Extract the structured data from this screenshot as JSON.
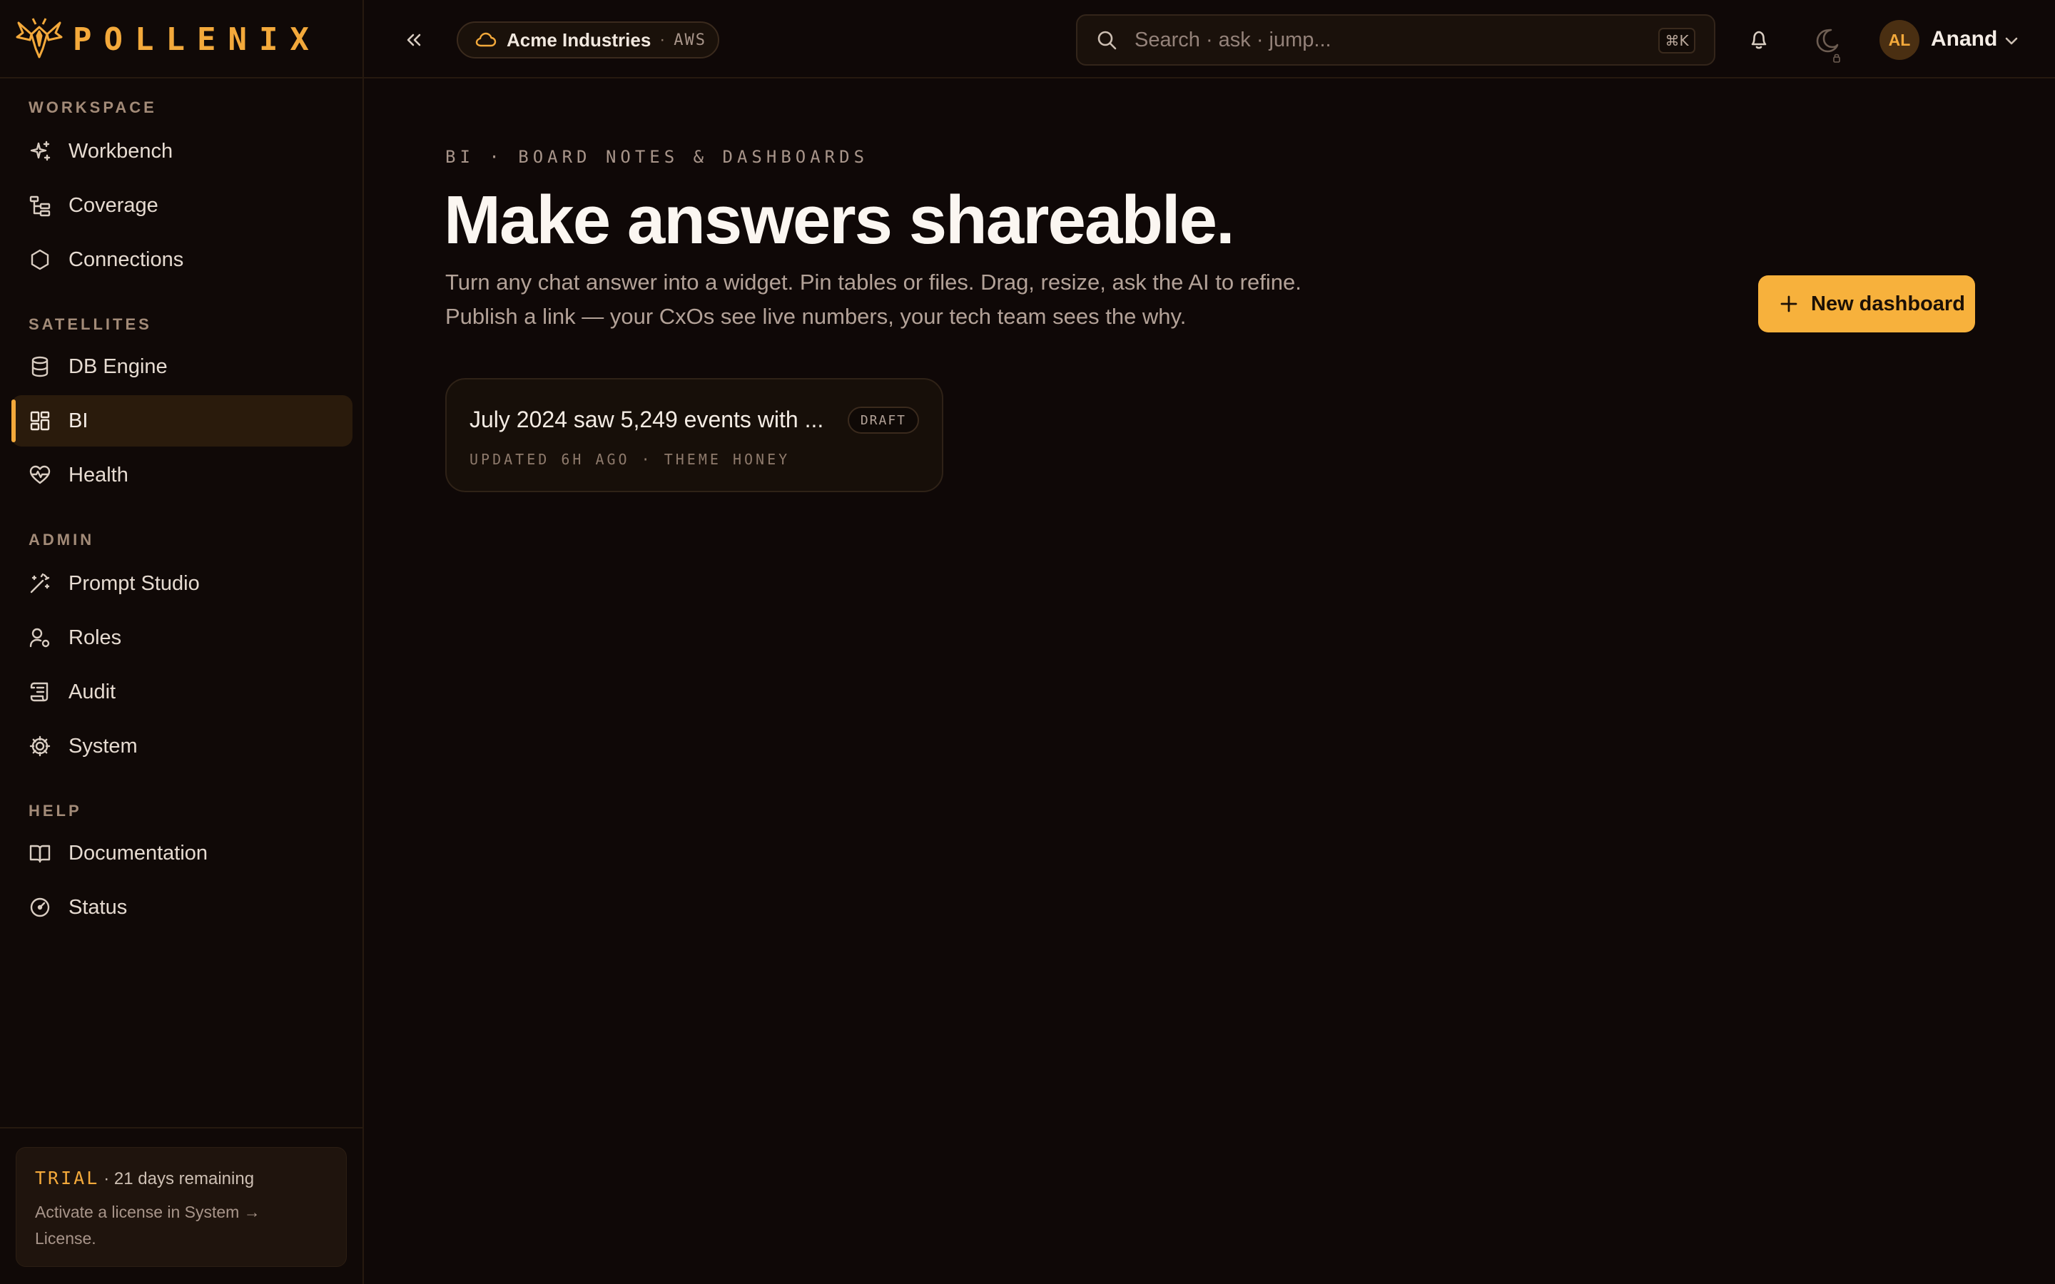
{
  "brand": {
    "name": "POLLENIX",
    "accent": "#f3a93b"
  },
  "sidebar": {
    "sections": [
      {
        "label": "WORKSPACE",
        "items": [
          {
            "label": "Workbench",
            "icon": "sparkles-icon"
          },
          {
            "label": "Coverage",
            "icon": "tree-icon"
          },
          {
            "label": "Connections",
            "icon": "hexagon-icon"
          }
        ]
      },
      {
        "label": "SATELLITES",
        "items": [
          {
            "label": "DB Engine",
            "icon": "database-icon"
          },
          {
            "label": "BI",
            "icon": "dashboard-icon",
            "active": true
          },
          {
            "label": "Health",
            "icon": "heart-pulse-icon"
          }
        ]
      },
      {
        "label": "ADMIN",
        "items": [
          {
            "label": "Prompt Studio",
            "icon": "wand-icon"
          },
          {
            "label": "Roles",
            "icon": "user-cog-icon"
          },
          {
            "label": "Audit",
            "icon": "scroll-icon"
          },
          {
            "label": "System",
            "icon": "gear-icon"
          }
        ]
      },
      {
        "label": "HELP",
        "items": [
          {
            "label": "Documentation",
            "icon": "book-icon"
          },
          {
            "label": "Status",
            "icon": "gauge-icon"
          }
        ]
      }
    ],
    "trial": {
      "tag": "TRIAL",
      "remaining": "· 21 days remaining",
      "body": "Activate a license in System → License."
    }
  },
  "topbar": {
    "tenant": {
      "name": "Acme Industries",
      "separator": "·",
      "cloud": "AWS"
    },
    "search": {
      "placeholder": "Search · ask · jump...",
      "shortcut": "⌘K"
    },
    "user": {
      "initials": "AL",
      "name": "Anand"
    }
  },
  "main": {
    "eyebrow": "BI · BOARD NOTES & DASHBOARDS",
    "title": "Make answers shareable.",
    "subtitle_line1": "Turn any chat answer into a widget. Pin tables or files. Drag, resize, ask the AI to refine.",
    "subtitle_line2": "Publish a link — your CxOs see live numbers, your tech team sees the why.",
    "new_button": "New dashboard",
    "dashboards": [
      {
        "title": "July 2024 saw 5,249 events with ...",
        "badge": "DRAFT",
        "meta": "UPDATED 6H AGO · THEME HONEY"
      }
    ]
  }
}
